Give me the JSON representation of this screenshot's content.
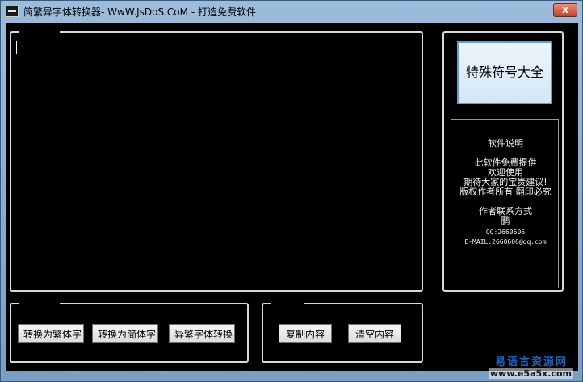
{
  "window": {
    "title": "简繁异字体转换器- WwW.JsDoS.CoM - 打造免费软件",
    "close_label": "x"
  },
  "editor": {
    "value": ""
  },
  "buttons": {
    "to_traditional": "转换为繁体字",
    "to_simplified": "转换为简体字",
    "variant_convert": "异繁字体转换",
    "copy_content": "复制内容",
    "clear_content": "清空内容",
    "special_symbols": "特殊符号大全"
  },
  "info": {
    "heading": "软件说明",
    "line1": "此软件免费提供",
    "line2": "欢迎使用",
    "line3": "期待大家的宝贵建议!",
    "line4": "版权作者所有 翻印必究",
    "contact_heading": "作者联系方式",
    "name": "鹏",
    "qq": "QQ:2660606",
    "email": "E-MAIL:2660606@qq.com"
  },
  "watermark": {
    "line1": "易语言资源网",
    "line2": "www.e5a5x.com"
  },
  "colors": {
    "background": "#000000",
    "accent": "#5aa0d6",
    "watermark": "#1e63c6"
  }
}
